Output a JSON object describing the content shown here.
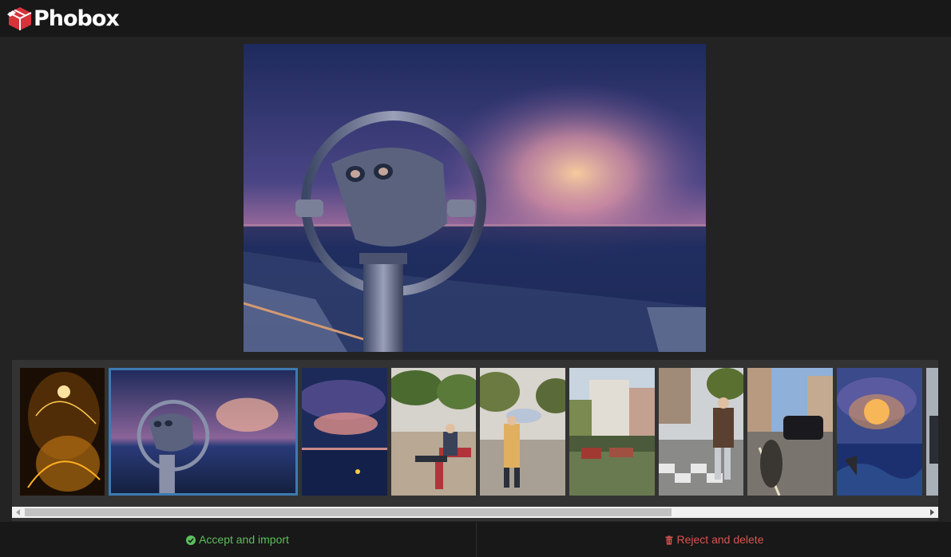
{
  "header": {
    "app_name": "Phobox",
    "logo_icon": "box-icon",
    "brand_color": "#d8323a"
  },
  "preview": {
    "icon": "coin-binoculars-image"
  },
  "filmstrip": {
    "selected_index": 1,
    "thumbnails": [
      {
        "name": "thumb-fireworks"
      },
      {
        "name": "thumb-binoculars"
      },
      {
        "name": "thumb-sunset-sea"
      },
      {
        "name": "thumb-man-on-bench"
      },
      {
        "name": "thumb-umbrella-walk"
      },
      {
        "name": "thumb-canal-houses"
      },
      {
        "name": "thumb-chess-street"
      },
      {
        "name": "thumb-taxi-street"
      },
      {
        "name": "thumb-sun-waves"
      },
      {
        "name": "thumb-partial"
      }
    ]
  },
  "actions": {
    "accept_label": "Accept and import",
    "accept_icon": "check-circle-icon",
    "accept_color": "#5bbf5b",
    "reject_label": "Reject and delete",
    "reject_icon": "trash-icon",
    "reject_color": "#d9534f"
  }
}
